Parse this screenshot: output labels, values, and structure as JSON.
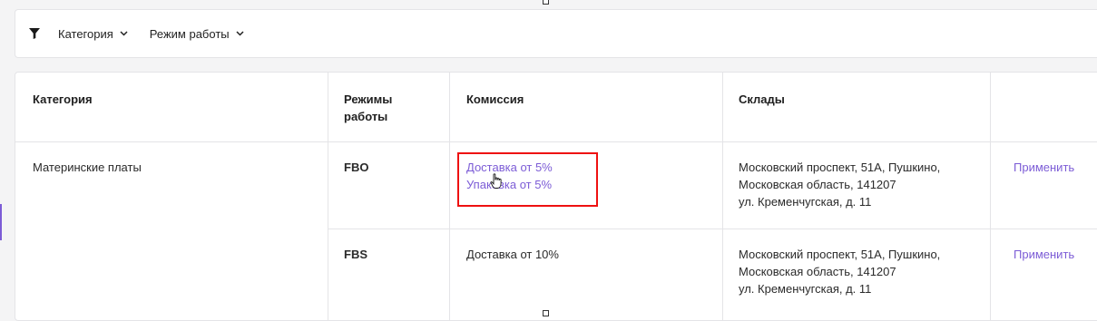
{
  "filters": {
    "category_label": "Категория",
    "mode_label": "Режим работы"
  },
  "table": {
    "headers": {
      "category": "Категория",
      "modes_line1": "Режимы",
      "modes_line2": "работы",
      "commission": "Комиссия",
      "warehouses": "Склады"
    },
    "group_category": "Материнские платы",
    "rows": [
      {
        "mode": "FBO",
        "commission": [
          "Доставка от 5%",
          "Упаковка от 5%"
        ],
        "warehouse": [
          "Московский проспект, 51А, Пушкино,",
          "Московская область, 141207",
          "ул. Кременчугская, д. 11"
        ],
        "action": "Применить"
      },
      {
        "mode": "FBS",
        "commission": [
          "Доставка от 10%"
        ],
        "warehouse": [
          "Московский проспект, 51А, Пушкино,",
          "Московская область, 141207",
          "ул. Кременчугская, д. 11"
        ],
        "action": "Применить"
      }
    ]
  },
  "colors": {
    "accent": "#7c5cd6",
    "highlight": "#e11111"
  },
  "icons": [
    "funnel-icon",
    "chevron-down-icon",
    "hand-cursor-icon"
  ]
}
